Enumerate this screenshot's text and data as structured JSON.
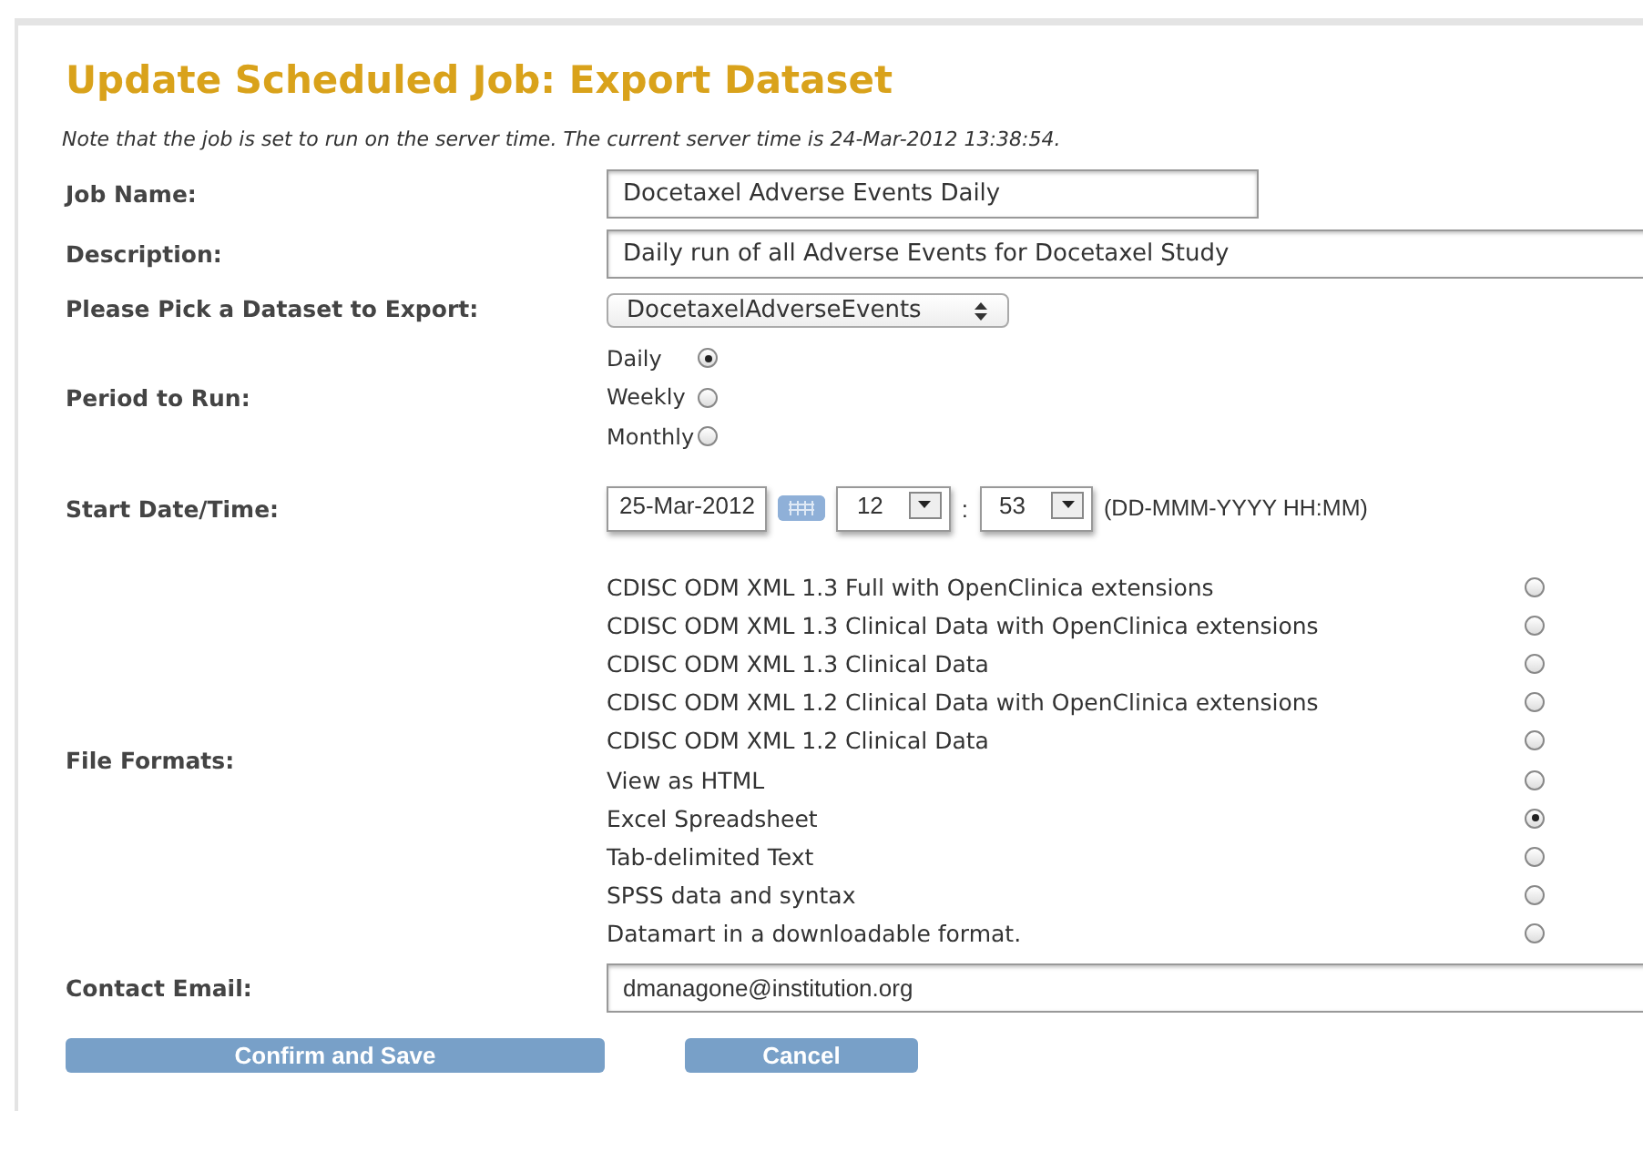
{
  "title": "Update Scheduled Job: Export Dataset",
  "note": "Note that the job is set to run on the server time. The current server time is 24-Mar-2012 13:38:54.",
  "job_name": {
    "label": "Job Name:",
    "value": "Docetaxel Adverse Events Daily"
  },
  "description": {
    "label": "Description:",
    "value": "Daily run of all Adverse Events for Docetaxel Study"
  },
  "dataset": {
    "label": "Please Pick a Dataset to Export:",
    "value": "DocetaxelAdverseEvents"
  },
  "period": {
    "label": "Period to Run:",
    "options": [
      {
        "label": "Daily",
        "selected": true
      },
      {
        "label": "Weekly",
        "selected": false
      },
      {
        "label": "Monthly",
        "selected": false
      }
    ]
  },
  "start": {
    "label": "Start Date/Time:",
    "date": "25-Mar-2012",
    "hour": "12",
    "separator": ":",
    "minute": "53",
    "hint": "(DD-MMM-YYYY HH:MM)"
  },
  "file_formats": {
    "label": "File Formats:",
    "options": [
      {
        "label": "CDISC ODM XML 1.3 Full with OpenClinica extensions",
        "selected": false
      },
      {
        "label": "CDISC ODM XML 1.3 Clinical Data with OpenClinica extensions",
        "selected": false
      },
      {
        "label": "CDISC ODM XML 1.3 Clinical Data",
        "selected": false
      },
      {
        "label": "CDISC ODM XML 1.2 Clinical Data with OpenClinica extensions",
        "selected": false
      },
      {
        "label": "CDISC ODM XML 1.2 Clinical Data",
        "selected": false
      },
      {
        "label": "View as HTML",
        "selected": false
      },
      {
        "label": "Excel Spreadsheet",
        "selected": true
      },
      {
        "label": "Tab-delimited Text",
        "selected": false
      },
      {
        "label": "SPSS data and syntax",
        "selected": false
      },
      {
        "label": "Datamart in a downloadable format.",
        "selected": false
      }
    ]
  },
  "contact": {
    "label": "Contact Email:",
    "value": "dmanagone@institution.org"
  },
  "buttons": [
    "Confirm and Save",
    "Cancel"
  ]
}
